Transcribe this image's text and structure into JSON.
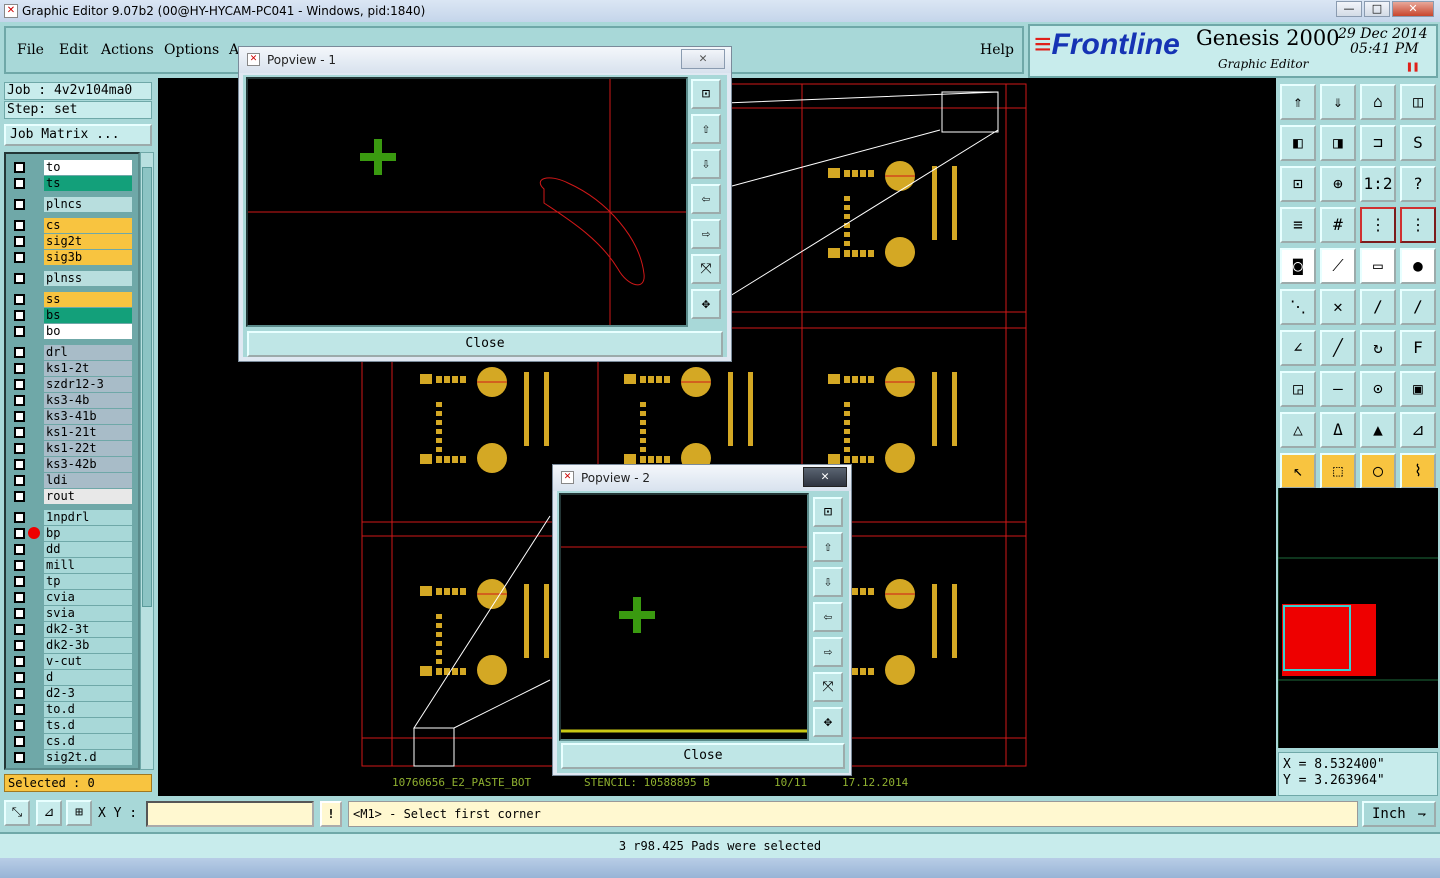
{
  "window": {
    "title": "Graphic Editor 9.07b2 (00@HY-HYCAM-PC041 - Windows, pid:1840)",
    "min": "—",
    "max": "□",
    "close": "✕"
  },
  "menu": {
    "items": [
      "File",
      "Edit",
      "Actions",
      "Options",
      "A",
      "",
      "",
      "",
      ""
    ],
    "help": "Help"
  },
  "brand": {
    "logo": "Frontline",
    "product": "Genesis 2000",
    "subtitle": "Graphic Editor",
    "date": "29 Dec 2014",
    "time": "05:41 PM",
    "pause_icon": "pause-icon"
  },
  "job": {
    "job_label": "Job : 4v2v104ma0",
    "step_label": "Step: set",
    "matrix_button": "Job Matrix ..."
  },
  "layers": [
    {
      "name": "to",
      "color": "#ffffff"
    },
    {
      "name": "ts",
      "color": "#13a07a"
    },
    {
      "name": "plncs",
      "color": "#b8dede"
    },
    {
      "name": "cs",
      "color": "#f8c440"
    },
    {
      "name": "sig2t",
      "color": "#f8c440"
    },
    {
      "name": "sig3b",
      "color": "#f8c440"
    },
    {
      "name": "plnss",
      "color": "#b8dede"
    },
    {
      "name": "ss",
      "color": "#f8c440"
    },
    {
      "name": "bs",
      "color": "#13a07a"
    },
    {
      "name": "bo",
      "color": "#ffffff"
    },
    {
      "name": "drl",
      "color": "#a8bcc8"
    },
    {
      "name": "ks1-2t",
      "color": "#a8bcc8"
    },
    {
      "name": "szdr12-3",
      "color": "#a8bcc8"
    },
    {
      "name": "ks3-4b",
      "color": "#a8bcc8"
    },
    {
      "name": "ks3-41b",
      "color": "#a8bcc8"
    },
    {
      "name": "ks1-21t",
      "color": "#a8bcc8"
    },
    {
      "name": "ks1-22t",
      "color": "#a8bcc8"
    },
    {
      "name": "ks3-42b",
      "color": "#a8bcc8"
    },
    {
      "name": "ldi",
      "color": "#a8bcc8"
    },
    {
      "name": "rout",
      "color": "#e8e8e8"
    },
    {
      "name": "1npdrl",
      "color": "#a8d8d8"
    },
    {
      "name": "bp",
      "color": "#a8d8d8",
      "marker": true
    },
    {
      "name": "dd",
      "color": "#a8d8d8"
    },
    {
      "name": "mill",
      "color": "#a8d8d8"
    },
    {
      "name": "tp",
      "color": "#a8d8d8"
    },
    {
      "name": "cvia",
      "color": "#a8d8d8"
    },
    {
      "name": "svia",
      "color": "#a8d8d8"
    },
    {
      "name": "dk2-3t",
      "color": "#a8d8d8"
    },
    {
      "name": "dk2-3b",
      "color": "#a8d8d8"
    },
    {
      "name": "v-cut",
      "color": "#a8d8d8"
    },
    {
      "name": "d",
      "color": "#a8d8d8"
    },
    {
      "name": "d2-3",
      "color": "#a8d8d8"
    },
    {
      "name": "to.d",
      "color": "#a8d8d8"
    },
    {
      "name": "ts.d",
      "color": "#a8d8d8"
    },
    {
      "name": "cs.d",
      "color": "#a8d8d8"
    },
    {
      "name": "sig2t.d",
      "color": "#a8d8d8"
    }
  ],
  "selected": "Selected : 0",
  "canvas": {
    "footer": [
      "10760656_E2_PASTE_BOT",
      "STENCIL: 10588895 B",
      "10/11",
      "17.12.2014"
    ],
    "colors": {
      "pad": "#d4a824",
      "profile": "#d01818",
      "cursor": "#3a9a10",
      "rubber": "#ffffff"
    }
  },
  "popview1": {
    "title": "Popview - 1",
    "close_label": "Close",
    "close_icon": "✕"
  },
  "popview2": {
    "title": "Popview - 2",
    "close_label": "Close",
    "close_icon": "✕"
  },
  "popview_tools": [
    "zoom-fit-icon",
    "pan-up-icon",
    "pan-down-icon",
    "pan-left-icon",
    "pan-right-icon",
    "zoom-out-icon",
    "zoom-in-icon"
  ],
  "toolbox": [
    [
      "zoom-home-icon",
      "zoom-prev-icon",
      "zoom-area-icon",
      "split-view-icon"
    ],
    [
      "pan-left-icon",
      "pan-right-icon",
      "step-repeat-icon",
      "snap-icon"
    ],
    [
      "zoom-out-icon",
      "zoom-in-icon",
      "scale-1to2-icon",
      "help-icon"
    ],
    [
      "measure-icon",
      "grid-icon",
      "net-highlight-icon",
      "net-select-icon"
    ],
    [
      "pad-icon",
      "line-icon",
      "ruler-icon",
      "round-pad-icon"
    ],
    [
      "connect-icon",
      "cross-icon",
      "node-red-icon",
      "node-blue-icon"
    ],
    [
      "angle-icon",
      "diagonal-icon",
      "rotate-icon",
      "mirror-icon"
    ],
    [
      "move-pad-icon",
      "cut-line-icon",
      "center-icon",
      "group-icon"
    ],
    [
      "triangle-red-icon",
      "triangle-up-icon",
      "triangle-blue-icon",
      "triangle-cross-icon"
    ],
    [
      "select-arrow-icon",
      "select-box-icon",
      "select-circle-icon",
      "select-net-icon"
    ]
  ],
  "toolbox_labels": {
    "scale": "1:2",
    "help": "?"
  },
  "coords": {
    "x": "X = 8.532400\"",
    "y": "Y = 3.263964\""
  },
  "bottom": {
    "xy_label": "X Y :",
    "xy_value": "",
    "excl": "!",
    "prompt": "<M1> - Select first corner",
    "units": "Inch"
  },
  "status": "3 r98.425 Pads were selected"
}
